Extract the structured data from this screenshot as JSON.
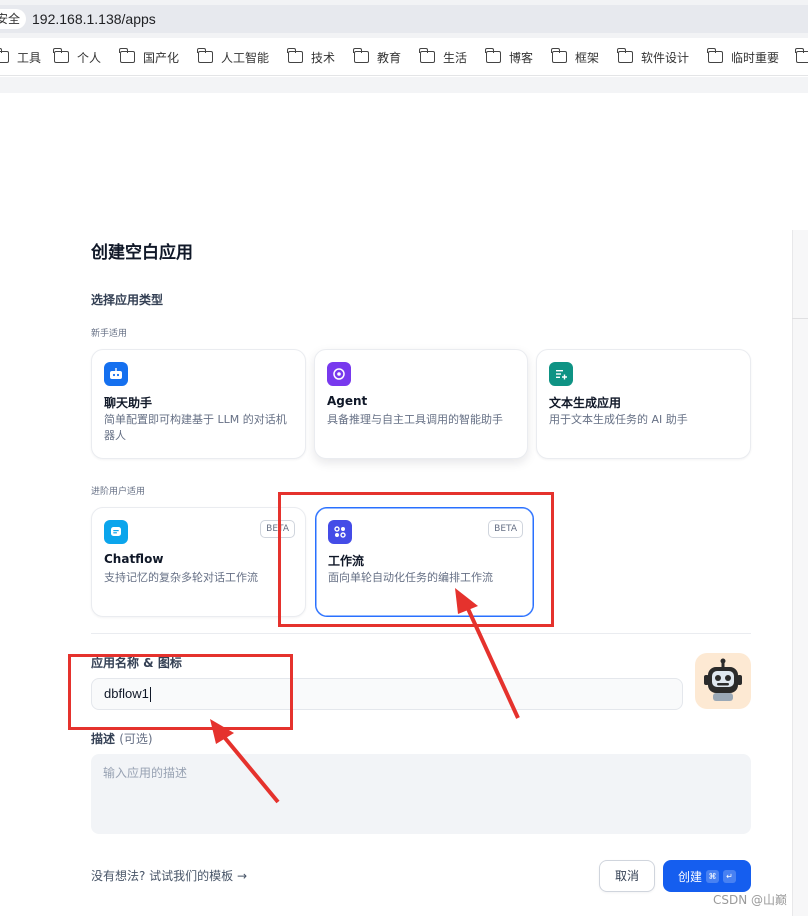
{
  "browser": {
    "secure_label": "安全",
    "url": "192.168.1.138/apps",
    "bookmarks": [
      {
        "label": "工具"
      },
      {
        "label": "个人"
      },
      {
        "label": "国产化"
      },
      {
        "label": "人工智能"
      },
      {
        "label": "技术"
      },
      {
        "label": "教育"
      },
      {
        "label": "生活"
      },
      {
        "label": "博客"
      },
      {
        "label": "框架"
      },
      {
        "label": "软件设计"
      },
      {
        "label": "临时重要"
      }
    ]
  },
  "dialog": {
    "title": "创建空白应用",
    "select_type_label": "选择应用类型",
    "beginner_label": "新手适用",
    "advanced_label": "进阶用户适用",
    "app_types": [
      {
        "title": "聊天助手",
        "desc": "简单配置即可构建基于 LLM 的对话机器人",
        "icon": "chat-bot-icon",
        "color": "#1570ef"
      },
      {
        "title": "Agent",
        "desc": "具备推理与自主工具调用的智能助手",
        "icon": "agent-brain-icon",
        "color": "#7839ee"
      },
      {
        "title": "文本生成应用",
        "desc": "用于文本生成任务的 AI 助手",
        "icon": "text-generation-icon",
        "color": "#0e9384"
      },
      {
        "title": "Chatflow",
        "desc": "支持记忆的复杂多轮对话工作流",
        "icon": "chatflow-icon",
        "color": "#0ba5ec",
        "badge": "BETA"
      },
      {
        "title": "工作流",
        "desc": "面向单轮自动化任务的编排工作流",
        "icon": "workflow-icon",
        "color": "#444ce7",
        "badge": "BETA",
        "selected": true
      }
    ],
    "name_label": "应用名称 & 图标",
    "name_value": "dbflow1",
    "app_icon": "robot-avatar-icon",
    "desc_label": "描述",
    "desc_optional": "(可选)",
    "desc_placeholder": "输入应用的描述",
    "template_link": "没有想法? 试试我们的模板 →",
    "cancel_label": "取消",
    "create_label": "创建",
    "create_shortcut": [
      "⌘",
      "↵"
    ]
  },
  "watermark": "CSDN @山巅",
  "annotation_color": "#e5322d"
}
